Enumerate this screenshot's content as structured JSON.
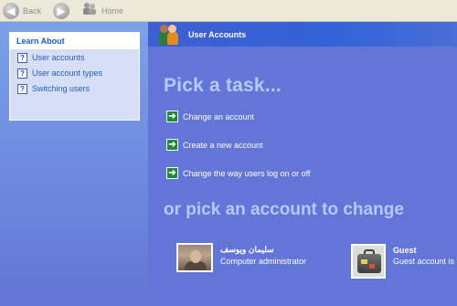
{
  "toolbar": {
    "back_label": "Back",
    "home_label": "Home",
    "back_icon": "back-arrow-icon",
    "forward_icon": "forward-arrow-icon",
    "home_icon": "home-icon"
  },
  "learn_about": {
    "title": "Learn About",
    "items": [
      {
        "label": "User accounts",
        "icon": "help-icon"
      },
      {
        "label": "User account types",
        "icon": "help-icon"
      },
      {
        "label": "Switching users",
        "icon": "help-icon"
      }
    ]
  },
  "main": {
    "header_title": "User Accounts",
    "pick_task_title": "Pick a task...",
    "tasks": [
      {
        "label": "Change an account",
        "icon": "green-arrow-icon"
      },
      {
        "label": "Create a new account",
        "icon": "green-arrow-icon"
      },
      {
        "label": "Change the way users log on or off",
        "icon": "green-arrow-icon"
      }
    ],
    "pick_account_title": "or pick an account to change",
    "accounts": [
      {
        "name": "سليمان ويوسف",
        "type": "Computer administrator"
      },
      {
        "name": "Guest",
        "type": "Guest account is"
      }
    ]
  },
  "colors": {
    "toolbar_bg": "#ece9d8",
    "main_bg": "#6375d6",
    "header_bg": "#3163d8",
    "title_text": "#b7c8f5",
    "link_blue": "#215dc6",
    "task_arrow_green": "#1d8a34"
  }
}
